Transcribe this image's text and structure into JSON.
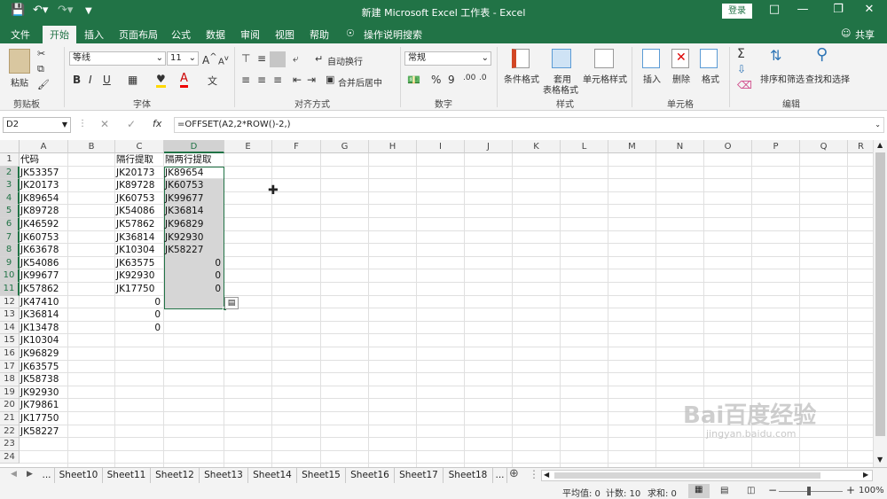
{
  "app": {
    "title": "新建 Microsoft Excel 工作表 - Excel",
    "login": "登录",
    "share": "共享"
  },
  "tabs": [
    "文件",
    "开始",
    "插入",
    "页面布局",
    "公式",
    "数据",
    "审阅",
    "视图",
    "帮助"
  ],
  "active_tab": "开始",
  "tell_me": "操作说明搜索",
  "ribbon": {
    "clipboard": {
      "paste": "粘贴",
      "label": "剪贴板"
    },
    "font": {
      "name": "等线",
      "size": "11",
      "label": "字体",
      "grow": "A",
      "shrink": "A",
      "bold": "B",
      "italic": "I",
      "underline": "U",
      "color_a": "A",
      "wen": "文"
    },
    "alignment": {
      "wrap": "自动换行",
      "merge": "合并后居中",
      "label": "对齐方式"
    },
    "number": {
      "format": "常规",
      "label": "数字",
      "percent": "%",
      "comma": "9"
    },
    "styles": {
      "conditional": "条件格式",
      "table1": "套用",
      "table2": "表格格式",
      "cell": "单元格样式",
      "label": "样式"
    },
    "cells": {
      "insert": "插入",
      "delete": "删除",
      "format": "格式",
      "label": "单元格"
    },
    "editing": {
      "sort": "排序和筛选",
      "find": "查找和选择",
      "label": "编辑"
    }
  },
  "formula": {
    "namebox": "D2",
    "fx": "fx",
    "formula": "=OFFSET(A2,2*ROW()-2,)"
  },
  "columns": [
    "A",
    "B",
    "C",
    "D",
    "E",
    "F",
    "G",
    "H",
    "I",
    "J",
    "K",
    "L",
    "M",
    "N",
    "O",
    "P",
    "Q",
    "R"
  ],
  "rows": [
    "1",
    "2",
    "3",
    "4",
    "5",
    "6",
    "7",
    "8",
    "9",
    "10",
    "11",
    "12",
    "13",
    "14",
    "15",
    "16",
    "17",
    "18",
    "19",
    "20",
    "21",
    "22",
    "23",
    "24"
  ],
  "colA": [
    "代码",
    "JK53357",
    "JK20173",
    "JK89654",
    "JK89728",
    "JK46592",
    "JK60753",
    "JK63678",
    "JK54086",
    "JK99677",
    "JK57862",
    "JK47410",
    "JK36814",
    "JK13478",
    "JK10304",
    "JK96829",
    "JK63575",
    "JK58738",
    "JK92930",
    "JK79861",
    "JK17750",
    "JK58227"
  ],
  "colC": [
    "隔行提取",
    "JK20173",
    "JK89728",
    "JK60753",
    "JK54086",
    "JK57862",
    "JK36814",
    "JK10304",
    "JK63575",
    "JK92930",
    "JK17750",
    "0",
    "0",
    "0"
  ],
  "colD": [
    "隔两行提取",
    "JK89654",
    "JK60753",
    "JK99677",
    "JK36814",
    "JK96829",
    "JK92930",
    "JK58227",
    "0",
    "0",
    "0"
  ],
  "sheets": [
    "...",
    "Sheet10",
    "Sheet11",
    "Sheet12",
    "Sheet13",
    "Sheet14",
    "Sheet15",
    "Sheet16",
    "Sheet17",
    "Sheet18",
    "..."
  ],
  "status": {
    "average": "平均值: 0",
    "count": "计数: 10",
    "sum": "求和: 0",
    "zoom": "100%",
    "minus": "−",
    "plus": "+"
  },
  "watermark": {
    "brand": "Bai百度经验",
    "url": "jingyan.baidu.com"
  }
}
